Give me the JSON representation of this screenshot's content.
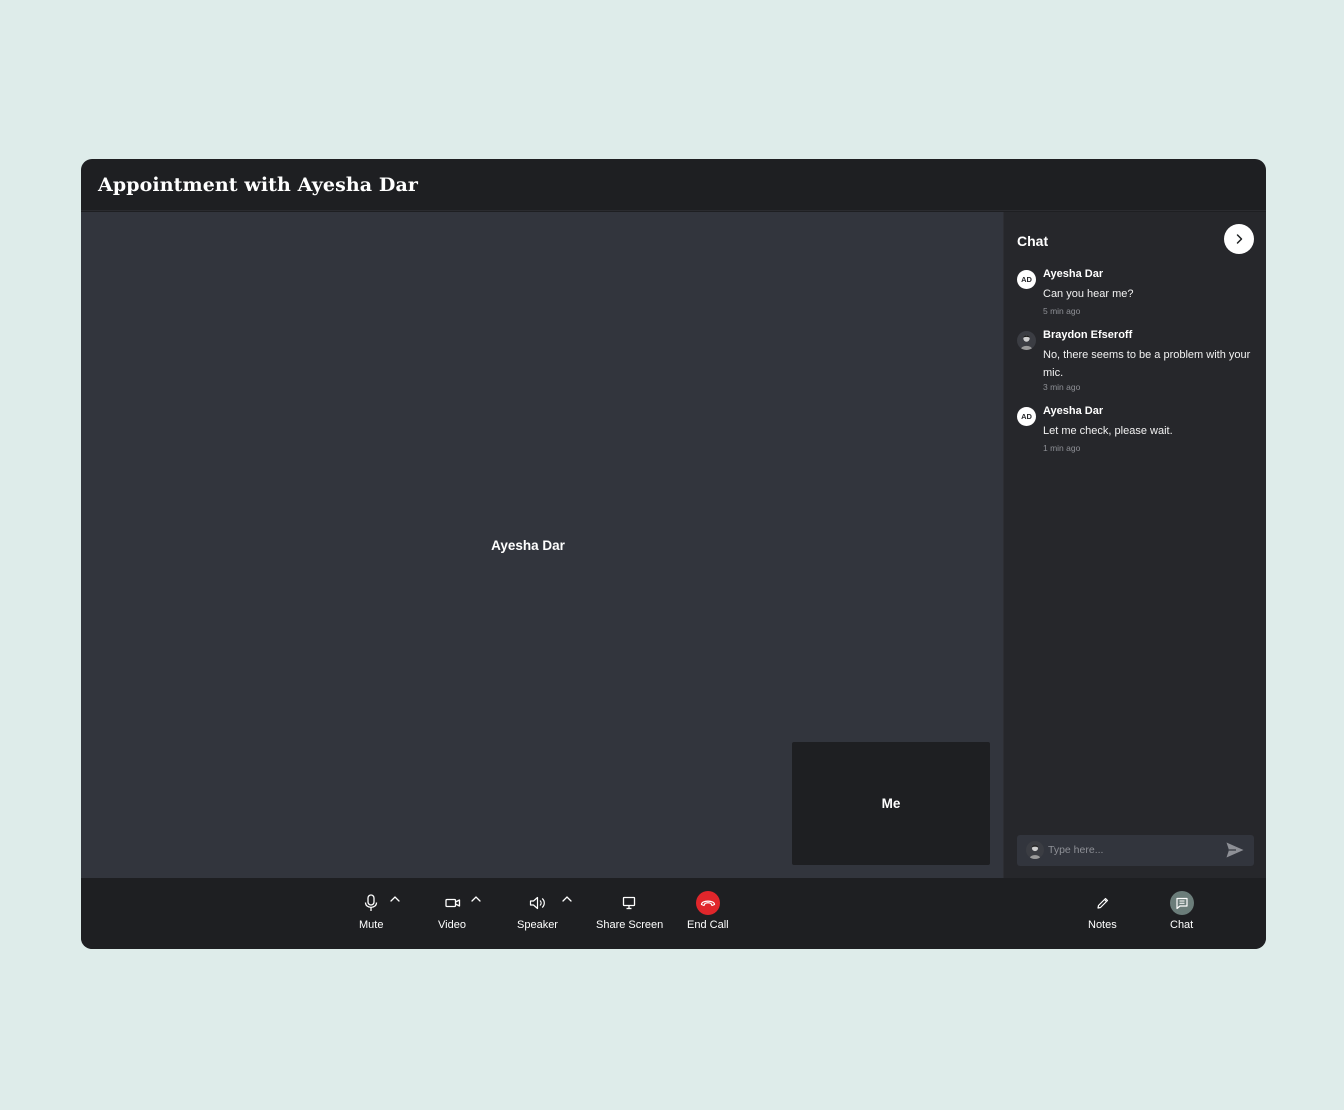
{
  "window": {
    "title": "Appointment with Ayesha Dar"
  },
  "stage": {
    "remote_name": "Ayesha Dar",
    "self_name": "Me"
  },
  "chat": {
    "title": "Chat",
    "messages": [
      {
        "initials": "AD",
        "sender": "Ayesha Dar",
        "text": "Can you hear me?",
        "time": "5 min ago",
        "avatar": "initials"
      },
      {
        "initials": "",
        "sender": "Braydon Efseroff",
        "text": "No, there seems to be a problem with your mic.",
        "time": "3 min ago",
        "avatar": "photo"
      },
      {
        "initials": "AD",
        "sender": "Ayesha Dar",
        "text": "Let me check, please wait.",
        "time": "1 min ago",
        "avatar": "initials"
      }
    ],
    "input": {
      "placeholder": "Type here...",
      "value": ""
    }
  },
  "controls": {
    "mute": "Mute",
    "video": "Video",
    "speaker": "Speaker",
    "share_screen": "Share Screen",
    "end_call": "End Call",
    "notes": "Notes",
    "chat": "Chat"
  },
  "icons": {
    "mute": "microphone-icon",
    "video": "video-camera-icon",
    "speaker": "speaker-icon",
    "share_screen": "monitor-icon",
    "end_call": "phone-hangup-icon",
    "notes": "pencil-icon",
    "chat": "chat-bubble-icon",
    "close_chat": "chevron-right-icon",
    "send": "send-icon"
  },
  "colors": {
    "background": "#deecea",
    "window": "#1e1f22",
    "stage": "#32353d",
    "chat_panel": "#26272b",
    "end_call": "#e0262b",
    "chat_active": "#6b7d7a"
  }
}
